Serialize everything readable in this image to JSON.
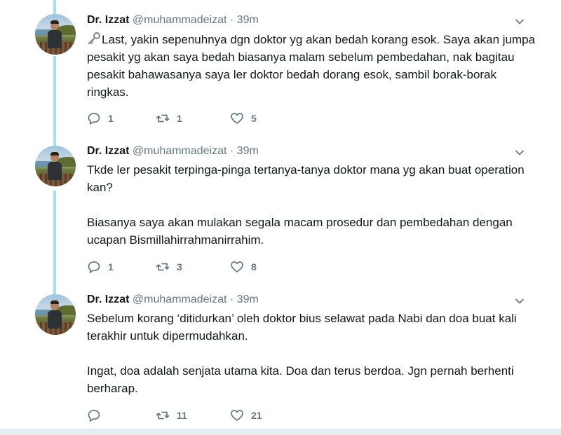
{
  "tweets": [
    {
      "name": "Dr. Izzat",
      "handle": "@muhammadeizat",
      "dot": "·",
      "time": "39m",
      "paragraphs": [
        "Last, yakin sepenuhnya dgn doktor yg akan bedah korang esok. Saya akan jumpa pesakit yg akan saya bedah biasanya malam sebelum pembedahan, nak bagitau pesakit bahawasanya saya ler doktor bedah dorang esok, sambil borak-borak ringkas."
      ],
      "leading_icon": "key-icon",
      "replies": "1",
      "retweets": "1",
      "likes": "5"
    },
    {
      "name": "Dr. Izzat",
      "handle": "@muhammadeizat",
      "dot": "·",
      "time": "39m",
      "paragraphs": [
        "Tkde ler pesakit terpinga-pinga tertanya-tanya doktor mana yg akan buat operation kan?",
        "Biasanya saya akan mulakan segala macam prosedur dan pembedahan dengan ucapan Bismillahirrahmanirrahim."
      ],
      "replies": "1",
      "retweets": "3",
      "likes": "8"
    },
    {
      "name": "Dr. Izzat",
      "handle": "@muhammadeizat",
      "dot": "·",
      "time": "39m",
      "paragraphs": [
        "Sebelum korang ‘ditidurkan’ oleh doktor bius selawat pada Nabi dan doa buat kali terakhir untuk dipermudahkan.",
        "Ingat, doa adalah senjata utama kita. Doa dan terus berdoa. Jgn pernah berhenti berharap."
      ],
      "replies": "",
      "retweets": "11",
      "likes": "21"
    }
  ],
  "colors": {
    "thread_line": "#a9dcf6",
    "text": "#14171a",
    "secondary": "#657786"
  }
}
